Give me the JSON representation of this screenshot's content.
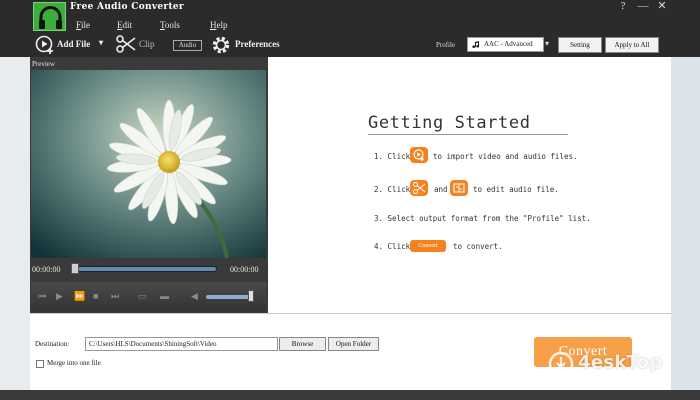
{
  "window": {
    "title": "Free Audio Converter",
    "controls": [
      "?",
      "—",
      "✕"
    ]
  },
  "menu": [
    "File",
    "Edit",
    "Tools",
    "Help"
  ],
  "toolbar": {
    "add_file": "Add File",
    "clip": "Clip",
    "audio_tag": "Audio",
    "preferences": "Preferences",
    "profile_label": "Profile",
    "profile_value": "AAC - Advanced",
    "setting": "Setting",
    "apply_to_all": "Apply to All"
  },
  "preview": {
    "label": "Preview",
    "time_current": "00:00:00",
    "time_total": "00:00:00"
  },
  "getting_started": {
    "title": "Getting Started",
    "step1_a": "1. Click",
    "step1_b": "to import video and audio files.",
    "step2_a": "2. Click",
    "step2_mid": "and",
    "step2_b": "to edit audio file.",
    "step3": "3. Select output format from the \"Profile\" list.",
    "step4_a": "4. Click",
    "step4_btn": "Convert",
    "step4_b": "to convert."
  },
  "output": {
    "destination_label": "Destination:",
    "destination_value": "C:\\Users\\HLS\\Documents\\ShiningSoft\\Video",
    "browse": "Browse",
    "open_folder": "Open Folder",
    "merge_label": "Merge into one file",
    "convert": "Convert"
  },
  "watermark": "4eskTop",
  "colors": {
    "accent": "#f4821f",
    "titlebar": "#2b2b2b",
    "logo": "#3cae3c"
  }
}
